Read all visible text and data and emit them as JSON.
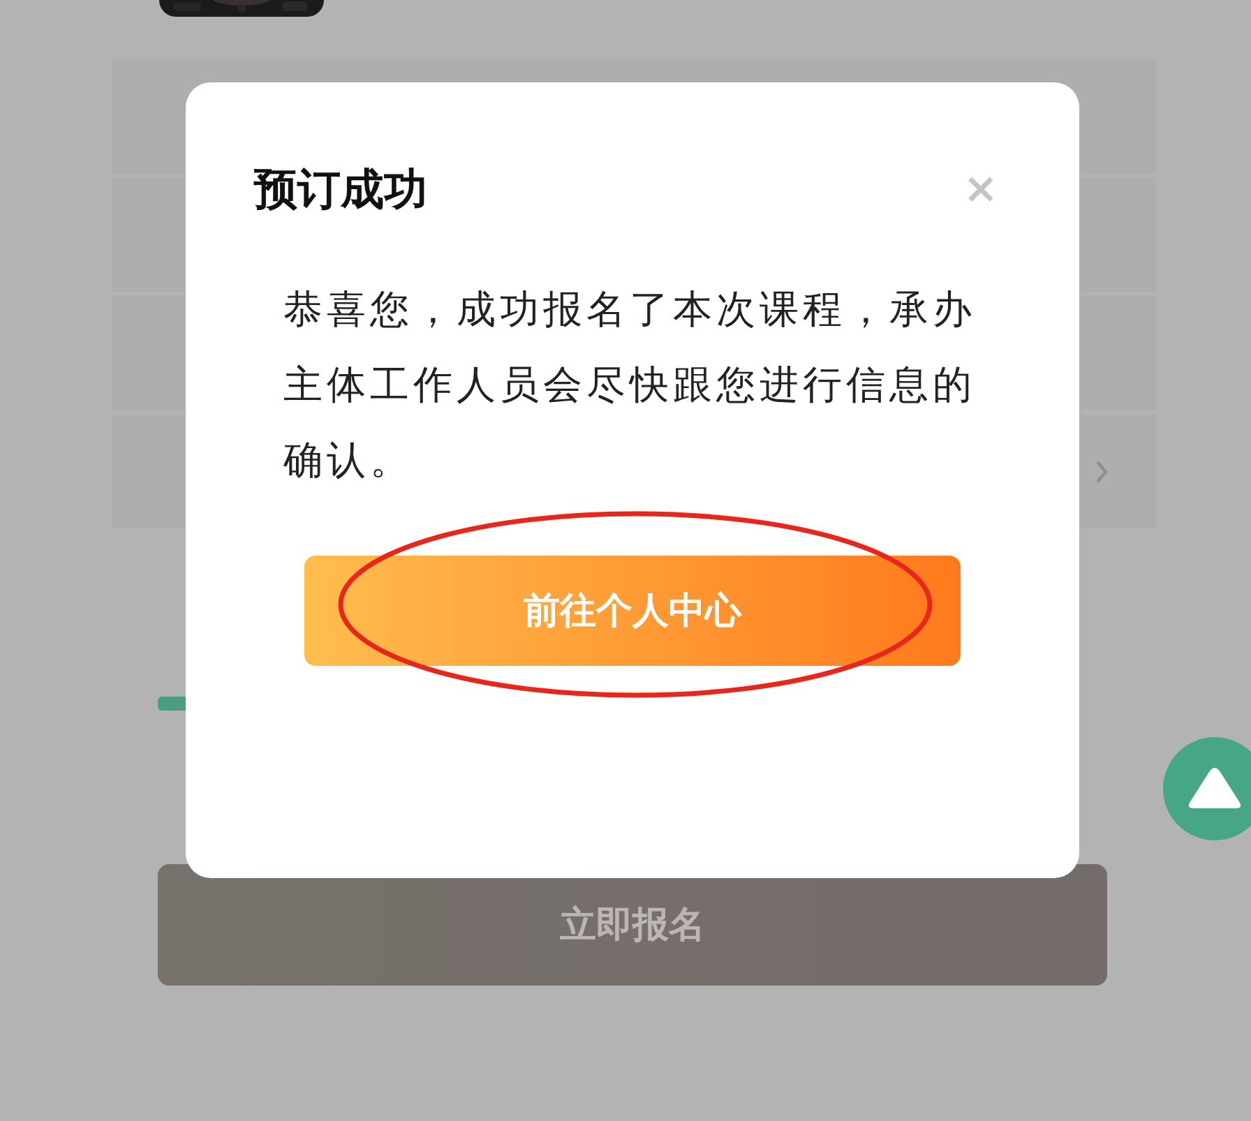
{
  "background": {
    "rows": [
      {
        "kind": "plain"
      },
      {
        "kind": "plain"
      },
      {
        "kind": "plain"
      },
      {
        "kind": "link"
      }
    ],
    "signup_button": "立即报名"
  },
  "dialog": {
    "title": "预订成功",
    "close": "×",
    "message": "恭喜您，成功报名了本次课程，承办主体工作人员会尽快跟您进行信息的确认。",
    "button": "前往个人中心"
  }
}
